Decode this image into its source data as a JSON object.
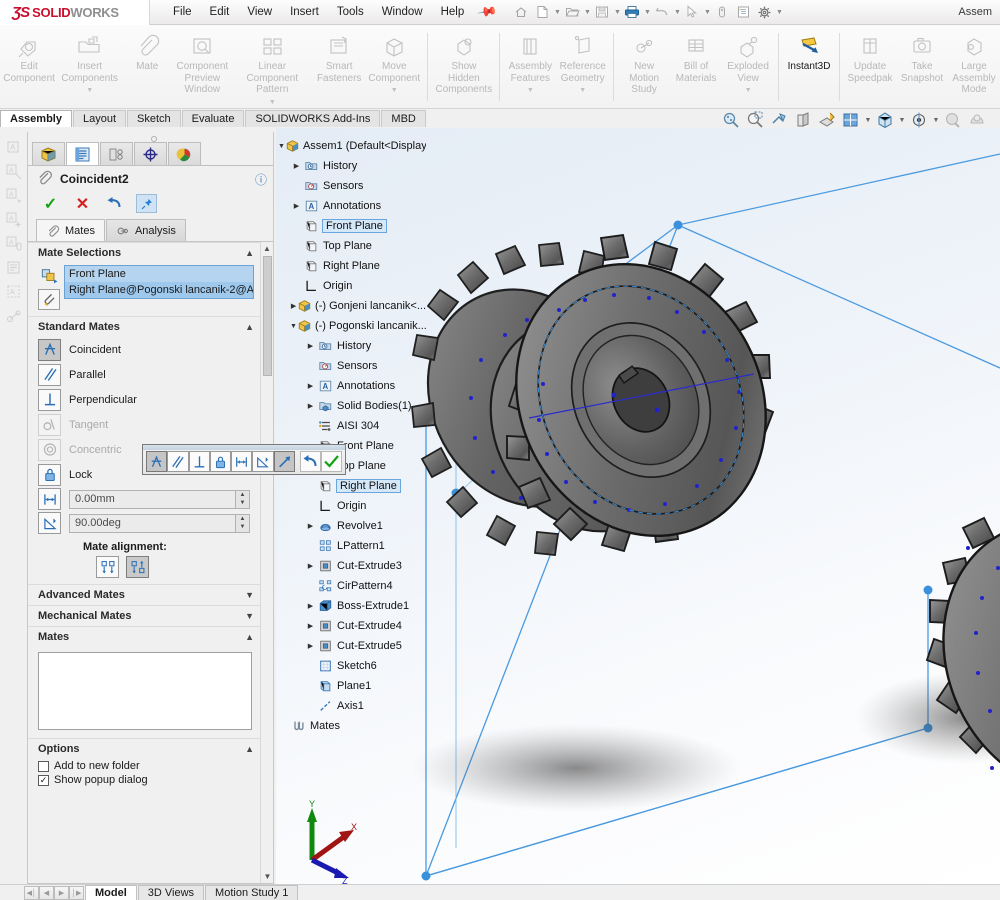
{
  "app": {
    "brand_ds": "ƷS",
    "brand_solid": "SOLID",
    "brand_works": "WORKS",
    "window_title": "Assem",
    "accent_blue": "#1f7fd4",
    "brand_red": "#c8102e"
  },
  "menu": {
    "items": [
      {
        "label": "File"
      },
      {
        "label": "Edit"
      },
      {
        "label": "View"
      },
      {
        "label": "Insert"
      },
      {
        "label": "Tools"
      },
      {
        "label": "Window"
      },
      {
        "label": "Help"
      }
    ],
    "pin_icon": "pin-icon"
  },
  "quickbar": {
    "items": [
      {
        "name": "home-icon",
        "caret": false
      },
      {
        "name": "new-document-icon",
        "caret": true
      },
      {
        "name": "open-folder-icon",
        "caret": true
      },
      {
        "name": "save-icon",
        "caret": true
      },
      {
        "name": "print-icon",
        "caret": true
      },
      {
        "name": "undo-icon",
        "caret": true
      },
      {
        "name": "select-cursor-icon",
        "caret": true
      },
      {
        "name": "rebuild-icon",
        "caret": false
      },
      {
        "name": "file-properties-icon",
        "caret": false
      },
      {
        "name": "options-gear-icon",
        "caret": true
      }
    ]
  },
  "ribbon": {
    "buttons": [
      {
        "label": "Edit\nComponent",
        "icon": "edit-component-icon",
        "dropdown": false,
        "active": false
      },
      {
        "label": "Insert\nComponents",
        "icon": "insert-components-icon",
        "dropdown": true,
        "active": false
      },
      {
        "label": "Mate",
        "icon": "mate-paperclip-icon",
        "dropdown": false,
        "active": false
      },
      {
        "label": "Component\nPreview\nWindow",
        "icon": "component-preview-icon",
        "dropdown": false,
        "active": false
      },
      {
        "label": "Linear Component\nPattern",
        "icon": "linear-pattern-icon",
        "dropdown": true,
        "active": false
      },
      {
        "label": "Smart\nFasteners",
        "icon": "smart-fasteners-icon",
        "dropdown": false,
        "active": false
      },
      {
        "label": "Move\nComponent",
        "icon": "move-component-icon",
        "dropdown": true,
        "active": false
      },
      {
        "label": "Show\nHidden\nComponents",
        "icon": "show-hidden-icon",
        "dropdown": false,
        "active": false
      },
      {
        "label": "Assembly\nFeatures",
        "icon": "assembly-features-icon",
        "dropdown": true,
        "active": false
      },
      {
        "label": "Reference\nGeometry",
        "icon": "reference-geometry-icon",
        "dropdown": true,
        "active": false
      },
      {
        "label": "New\nMotion\nStudy",
        "icon": "new-motion-study-icon",
        "dropdown": false,
        "active": false
      },
      {
        "label": "Bill of\nMaterials",
        "icon": "bill-of-materials-icon",
        "dropdown": false,
        "active": false
      },
      {
        "label": "Exploded\nView",
        "icon": "exploded-view-icon",
        "dropdown": true,
        "active": false
      },
      {
        "label": "Instant3D",
        "icon": "instant3d-icon",
        "dropdown": false,
        "active": true
      },
      {
        "label": "Update\nSpeedpak",
        "icon": "update-speedpak-icon",
        "dropdown": false,
        "active": false
      },
      {
        "label": "Take\nSnapshot",
        "icon": "take-snapshot-icon",
        "dropdown": false,
        "active": false
      },
      {
        "label": "Large\nAssembly\nMode",
        "icon": "large-assembly-icon",
        "dropdown": false,
        "active": false
      }
    ],
    "separators_after": [
      6,
      7,
      9,
      12,
      13
    ]
  },
  "command_tabs": {
    "items": [
      {
        "label": "Assembly",
        "selected": true
      },
      {
        "label": "Layout",
        "selected": false
      },
      {
        "label": "Sketch",
        "selected": false
      },
      {
        "label": "Evaluate",
        "selected": false
      },
      {
        "label": "SOLIDWORKS Add-Ins",
        "selected": false
      },
      {
        "label": "MBD",
        "selected": false
      }
    ]
  },
  "left_toolbar": {
    "items": [
      {
        "name": "note-icon"
      },
      {
        "name": "note-leader-icon"
      },
      {
        "name": "note-arrow-icon"
      },
      {
        "name": "add-note-icon"
      },
      {
        "name": "note-balloon-icon"
      },
      {
        "name": "block-icon"
      },
      {
        "name": "area-hatch-icon"
      },
      {
        "name": "belt-chain-icon"
      }
    ]
  },
  "property_manager": {
    "tabs": [
      {
        "name": "feature-manager-tab",
        "selected": false
      },
      {
        "name": "property-manager-tab",
        "selected": true
      },
      {
        "name": "configuration-manager-tab",
        "selected": false
      },
      {
        "name": "dimxpert-manager-tab",
        "selected": false
      },
      {
        "name": "display-manager-tab",
        "selected": false
      }
    ],
    "title": "Coincident2",
    "title_icon": "mate-paperclip-icon",
    "help_icon": "help-question-icon",
    "actions": [
      {
        "name": "ok-checkmark-button",
        "glyph": "✓",
        "kind": "ok"
      },
      {
        "name": "cancel-x-button",
        "glyph": "✕",
        "kind": "cancel"
      },
      {
        "name": "undo-button",
        "glyph": "↶",
        "kind": "undo"
      },
      {
        "name": "keep-visible-pin-button",
        "glyph": "✐",
        "kind": "pin"
      }
    ],
    "sub_tabs": [
      {
        "label": "Mates",
        "icon": "mate-paperclip-icon",
        "selected": true
      },
      {
        "label": "Analysis",
        "icon": "analysis-icon",
        "selected": false
      }
    ],
    "mate_selections": {
      "header": "Mate Selections",
      "entities": [
        {
          "label": "Front Plane",
          "selected": false
        },
        {
          "label": "Right Plane@Pogonski lancanik-2@A",
          "selected": true
        }
      ],
      "icons": [
        {
          "name": "mate-selection-icon"
        },
        {
          "name": "multiple-mate-mode-icon"
        }
      ]
    },
    "standard_mates": {
      "header": "Standard Mates",
      "items": [
        {
          "label": "Coincident",
          "icon": "coincident-icon",
          "enabled": true,
          "active": true
        },
        {
          "label": "Parallel",
          "icon": "parallel-icon",
          "enabled": true,
          "active": false
        },
        {
          "label": "Perpendicular",
          "icon": "perpendicular-icon",
          "enabled": true,
          "active": false
        },
        {
          "label": "Tangent",
          "icon": "tangent-icon",
          "enabled": false,
          "active": false
        },
        {
          "label": "Concentric",
          "icon": "concentric-icon",
          "enabled": false,
          "active": false
        },
        {
          "label": "Lock",
          "icon": "lock-icon",
          "enabled": true,
          "active": false
        }
      ],
      "distance": {
        "icon": "distance-icon",
        "value": "0.00mm"
      },
      "angle": {
        "icon": "angle-icon",
        "value": "90.00deg"
      },
      "alignment_label": "Mate alignment:",
      "alignment_buttons": [
        {
          "name": "aligned-button",
          "active": false
        },
        {
          "name": "anti-aligned-button",
          "active": true
        }
      ]
    },
    "advanced_mates": {
      "header": "Advanced Mates",
      "collapsed": true
    },
    "mechanical_mates": {
      "header": "Mechanical Mates",
      "collapsed": true
    },
    "mates": {
      "header": "Mates",
      "items": []
    },
    "options": {
      "header": "Options",
      "items": [
        {
          "label": "Add to new folder",
          "checked": false
        },
        {
          "label": "Show popup dialog",
          "checked": true
        }
      ]
    }
  },
  "feature_tree": {
    "nodes": [
      {
        "label": "Assem1  (Default<Display...",
        "icon": "assembly-icon",
        "depth": 0,
        "expander": "down",
        "selected": false
      },
      {
        "label": "History",
        "icon": "history-icon",
        "depth": 1,
        "expander": "right",
        "selected": false
      },
      {
        "label": "Sensors",
        "icon": "sensors-icon",
        "depth": 1,
        "expander": "none",
        "selected": false
      },
      {
        "label": "Annotations",
        "icon": "annotations-icon",
        "depth": 1,
        "expander": "right",
        "selected": false
      },
      {
        "label": "Front Plane",
        "icon": "plane-icon",
        "depth": 1,
        "expander": "none",
        "selected": true
      },
      {
        "label": "Top Plane",
        "icon": "plane-icon",
        "depth": 1,
        "expander": "none",
        "selected": false
      },
      {
        "label": "Right Plane",
        "icon": "plane-icon",
        "depth": 1,
        "expander": "none",
        "selected": false
      },
      {
        "label": "Origin",
        "icon": "origin-icon",
        "depth": 1,
        "expander": "none",
        "selected": false
      },
      {
        "label": "(-) Gonjeni lancanik<...",
        "icon": "part-icon",
        "depth": 1,
        "expander": "right",
        "selected": false
      },
      {
        "label": "(-) Pogonski lancanik...",
        "icon": "part-icon",
        "depth": 1,
        "expander": "down",
        "selected": false
      },
      {
        "label": "History",
        "icon": "history-icon",
        "depth": 2,
        "expander": "right",
        "selected": false
      },
      {
        "label": "Sensors",
        "icon": "sensors-icon",
        "depth": 2,
        "expander": "none",
        "selected": false
      },
      {
        "label": "Annotations",
        "icon": "annotations-icon",
        "depth": 2,
        "expander": "right",
        "selected": false
      },
      {
        "label": "Solid Bodies(1)",
        "icon": "solid-bodies-icon",
        "depth": 2,
        "expander": "right",
        "selected": false
      },
      {
        "label": "AISI 304",
        "icon": "material-icon",
        "depth": 2,
        "expander": "none",
        "selected": false
      },
      {
        "label": "Front Plane",
        "icon": "plane-icon",
        "depth": 2,
        "expander": "none",
        "selected": false
      },
      {
        "label": "Top Plane",
        "icon": "plane-icon",
        "depth": 2,
        "expander": "none",
        "selected": false
      },
      {
        "label": "Right Plane",
        "icon": "plane-icon",
        "depth": 2,
        "expander": "none",
        "selected": true
      },
      {
        "label": "Origin",
        "icon": "origin-icon",
        "depth": 2,
        "expander": "none",
        "selected": false
      },
      {
        "label": "Revolve1",
        "icon": "revolve-icon",
        "depth": 2,
        "expander": "right",
        "selected": false
      },
      {
        "label": "LPattern1",
        "icon": "linear-pattern-icon",
        "depth": 2,
        "expander": "none",
        "selected": false
      },
      {
        "label": "Cut-Extrude3",
        "icon": "cut-extrude-icon",
        "depth": 2,
        "expander": "right",
        "selected": false
      },
      {
        "label": "CirPattern4",
        "icon": "circular-pattern-icon",
        "depth": 2,
        "expander": "none",
        "selected": false
      },
      {
        "label": "Boss-Extrude1",
        "icon": "boss-extrude-icon",
        "depth": 2,
        "expander": "right",
        "selected": false
      },
      {
        "label": "Cut-Extrude4",
        "icon": "cut-extrude-icon",
        "depth": 2,
        "expander": "right",
        "selected": false
      },
      {
        "label": "Cut-Extrude5",
        "icon": "cut-extrude-icon",
        "depth": 2,
        "expander": "right",
        "selected": false
      },
      {
        "label": "Sketch6",
        "icon": "sketch-icon",
        "depth": 2,
        "expander": "none",
        "selected": false
      },
      {
        "label": "Plane1",
        "icon": "plane-icon",
        "depth": 2,
        "expander": "none",
        "selected": false
      },
      {
        "label": "Axis1",
        "icon": "axis-icon",
        "depth": 2,
        "expander": "none",
        "selected": false
      },
      {
        "label": "Mates",
        "icon": "mates-folder-icon",
        "depth": 1,
        "expander": "none",
        "selected": false
      }
    ]
  },
  "view_toolbar": {
    "items": [
      {
        "name": "zoom-to-fit-icon",
        "caret": false
      },
      {
        "name": "zoom-to-area-icon",
        "caret": false
      },
      {
        "name": "previous-view-icon",
        "caret": false
      },
      {
        "name": "section-view-icon",
        "caret": false
      },
      {
        "name": "view-orientation-icon",
        "caret": false
      },
      {
        "name": "display-style-icon",
        "caret": true
      },
      {
        "name": "hide-show-items-icon",
        "caret": true
      },
      {
        "name": "edit-appearance-icon",
        "caret": true
      },
      {
        "name": "apply-scene-icon",
        "caret": false
      },
      {
        "name": "view-settings-icon",
        "caret": false
      }
    ]
  },
  "mate_popup": {
    "buttons": [
      {
        "name": "coincident-popup-button",
        "icon": "coincident-icon",
        "pressed": true
      },
      {
        "name": "parallel-popup-button",
        "icon": "parallel-icon",
        "pressed": false
      },
      {
        "name": "perpendicular-popup-button",
        "icon": "perpendicular-icon",
        "pressed": false
      },
      {
        "name": "lock-popup-button",
        "icon": "lock-icon",
        "pressed": false
      },
      {
        "name": "distance-popup-button",
        "icon": "distance-icon",
        "pressed": false
      },
      {
        "name": "angle-popup-button",
        "icon": "angle-icon",
        "pressed": false
      },
      {
        "name": "alignment-popup-button",
        "icon": "alignment-arrow-icon",
        "pressed": true
      },
      {
        "name": "undo-popup-button",
        "icon": "undo-icon",
        "pressed": false
      },
      {
        "name": "ok-popup-button",
        "icon": "checkmark-icon",
        "pressed": false
      }
    ]
  },
  "triad": {
    "x_label": "X",
    "y_label": "Y",
    "z_label": "Z",
    "x_color": "#a11414",
    "y_color": "#0f8a0f",
    "z_color": "#1a1ab0"
  },
  "bottom_bar": {
    "nav_buttons": [
      "◀│",
      "◀",
      "▶",
      "│▶"
    ],
    "tabs": [
      {
        "label": "Model",
        "selected": true
      },
      {
        "label": "3D Views",
        "selected": false
      },
      {
        "label": "Motion Study 1",
        "selected": false
      }
    ]
  }
}
